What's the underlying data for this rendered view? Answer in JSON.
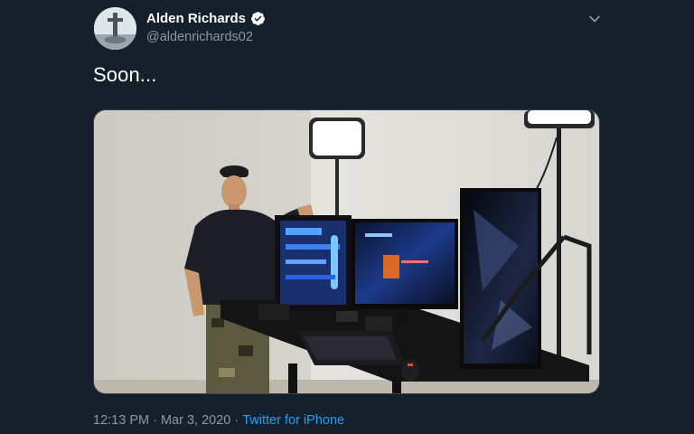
{
  "tweet": {
    "display_name": "Alden Richards",
    "handle": "@aldenrichards02",
    "verified": true,
    "text": "Soon...",
    "time": "12:13 PM",
    "separator": " · ",
    "date": "Mar 3, 2020",
    "source": "Twitter for iPhone",
    "more_icon": "chevron-down-icon",
    "verified_icon": "verified-badge-icon"
  },
  "colors": {
    "background": "#15202b",
    "secondary_text": "#8899a6",
    "link": "#1da1f2",
    "verified": "#ffffff"
  }
}
